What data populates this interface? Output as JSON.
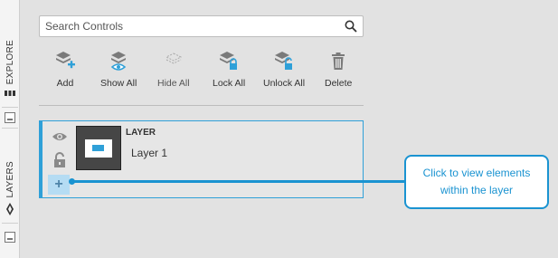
{
  "sidebar": {
    "tabs": [
      {
        "label": "EXPLORE"
      },
      {
        "label": "LAYERS"
      }
    ]
  },
  "search": {
    "placeholder": "Search Controls"
  },
  "toolbar": {
    "add_label": "Add",
    "show_all_label": "Show All",
    "hide_all_label": "Hide All",
    "lock_all_label": "Lock All",
    "unlock_all_label": "Unlock All",
    "delete_label": "Delete"
  },
  "layer": {
    "type_label": "LAYER",
    "name": "Layer 1"
  },
  "callout": {
    "text": "Click to view elements within the layer"
  },
  "colors": {
    "accent": "#2fa0d8",
    "callout": "#1a93d1",
    "icon_gray": "#8a8a8a"
  },
  "icons": [
    "search-icon",
    "add-layer-icon",
    "show-all-icon",
    "hide-all-icon",
    "lock-all-icon",
    "unlock-all-icon",
    "delete-icon",
    "visibility-eye-icon",
    "unlock-icon",
    "plus-icon"
  ]
}
